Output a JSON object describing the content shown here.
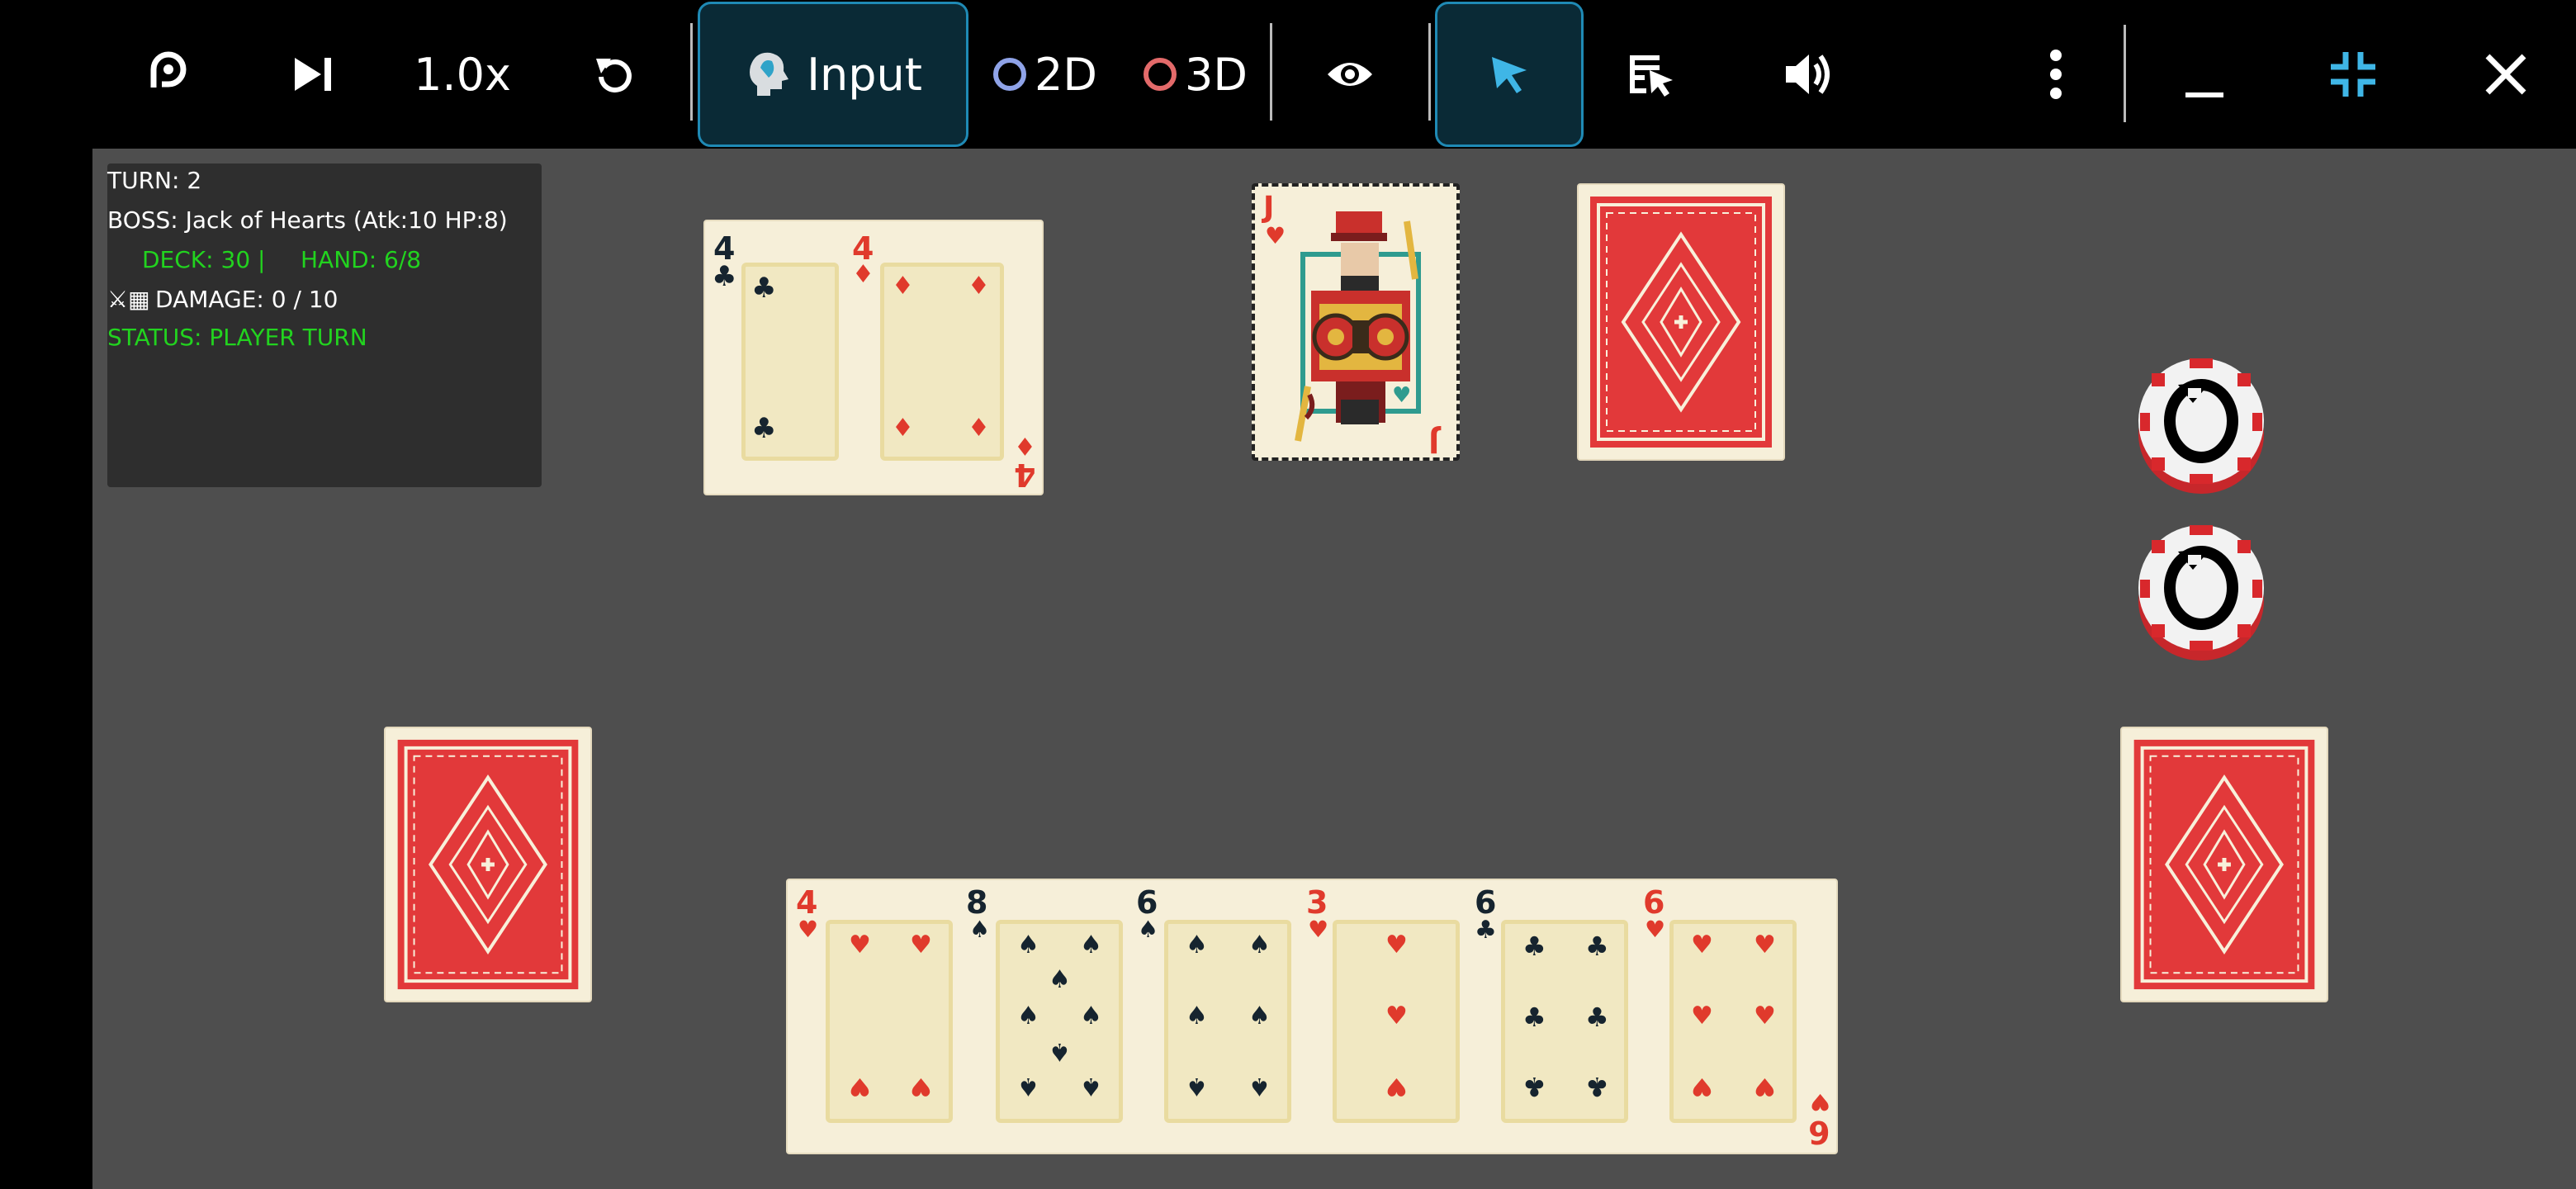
{
  "toolbar": {
    "speed_label": "1.0x",
    "input_label": "Input",
    "mode_2d_label": "2D",
    "mode_3d_label": "3D",
    "colors": {
      "accent": "#1f8ab5",
      "ring_2d": "#8fa3e8",
      "ring_3d": "#e36a6a"
    },
    "icons": [
      "app-logo-icon",
      "step-forward-icon",
      "reset-icon",
      "input-head-icon",
      "eye-icon",
      "pointer-icon",
      "macro-list-icon",
      "volume-icon",
      "more-vert-icon",
      "minimize-icon",
      "shrink-icon",
      "close-icon"
    ]
  },
  "hud": {
    "turn": "TURN: 2",
    "boss": "BOSS: Jack of Hearts (Atk:10 HP:8)",
    "deck": "DECK: 30 |",
    "hand": "HAND: 6/8",
    "damage_icon": "⚔▦",
    "damage": "DAMAGE: 0 / 10",
    "status": "STATUS: PLAYER TURN"
  },
  "played": {
    "cards": [
      {
        "rank": "4",
        "suit": "♣",
        "color": "black"
      },
      {
        "rank": "4",
        "suit": "♦",
        "color": "red"
      }
    ],
    "last_rank": "4"
  },
  "boss_card": {
    "rank": "J",
    "suit": "♥"
  },
  "hand": {
    "cards": [
      {
        "rank": "4",
        "suit": "♥"
      },
      {
        "rank": "8",
        "suit": "♠"
      },
      {
        "rank": "6",
        "suit": "♠"
      },
      {
        "rank": "3",
        "suit": "♥"
      },
      {
        "rank": "6",
        "suit": "♣"
      },
      {
        "rank": "6",
        "suit": "♥"
      }
    ],
    "last_rank": "6",
    "last_suit": "♥"
  }
}
